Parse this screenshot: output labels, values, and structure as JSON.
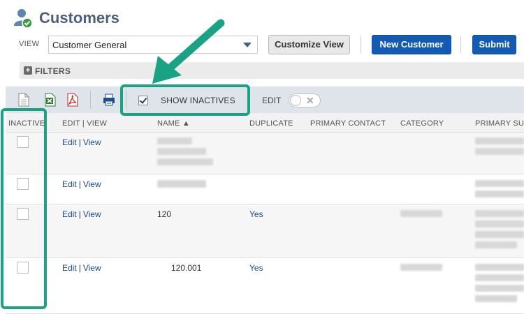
{
  "page": {
    "title": "Customers"
  },
  "view": {
    "label": "VIEW",
    "selected": "Customer General",
    "customize_label": "Customize View",
    "new_customer_label": "New Customer",
    "submit_label": "Submit"
  },
  "filters": {
    "label": "FILTERS"
  },
  "toolbar": {
    "show_inactives_label": "SHOW INACTIVES",
    "show_inactives_checked": true,
    "edit_label": "EDIT",
    "edit_toggle_on": false,
    "icons": [
      "document-icon",
      "excel-export-icon",
      "pdf-export-icon",
      "print-icon"
    ]
  },
  "table": {
    "columns": [
      "INACTIVE",
      "EDIT | VIEW",
      "NAME ▲",
      "DUPLICATE",
      "PRIMARY CONTACT",
      "CATEGORY",
      "PRIMARY SUB"
    ],
    "rows": [
      {
        "edit": "Edit",
        "view": "View",
        "name": "",
        "duplicate": "",
        "inactive": false
      },
      {
        "edit": "Edit",
        "view": "View",
        "name": "",
        "duplicate": "",
        "inactive": false
      },
      {
        "edit": "Edit",
        "view": "View",
        "name": "120",
        "duplicate": "Yes",
        "inactive": false
      },
      {
        "edit": "Edit",
        "view": "View",
        "name": "120.001",
        "duplicate": "Yes",
        "inactive": false
      }
    ]
  },
  "colors": {
    "title": "#4d5f79",
    "primary_button": "#125ab2",
    "link": "#1a4a8b",
    "annotation": "#19a384",
    "toolbar_bg": "#dfe4eb"
  }
}
